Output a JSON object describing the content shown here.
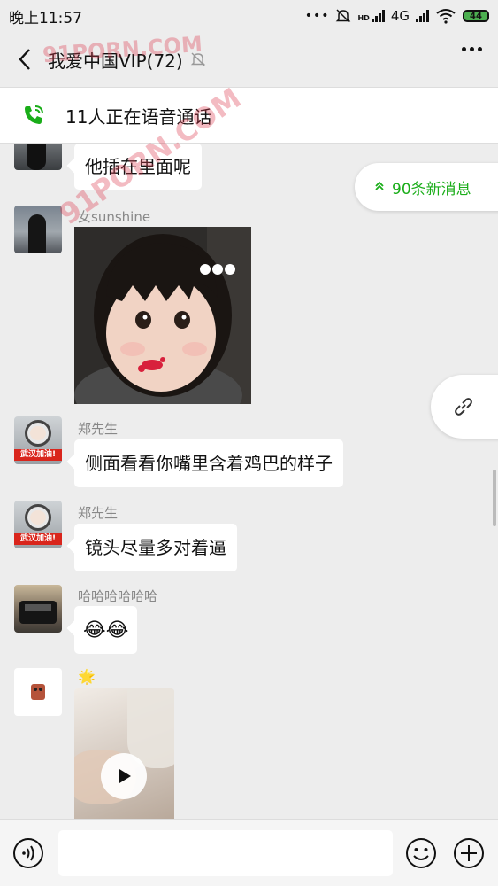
{
  "status_bar": {
    "time": "晚上11:57",
    "dots": "•••",
    "hd": "HD",
    "network": "4G",
    "battery": "44"
  },
  "nav": {
    "title": "我爱中国VIP(72)"
  },
  "voice_banner": {
    "text": "11人正在语音通话"
  },
  "new_messages": {
    "label": "90条新消息"
  },
  "messages": [
    {
      "text": "他插在里面呢"
    },
    {
      "sender": "女sunshine",
      "type": "image"
    },
    {
      "sender": "郑先生",
      "avatar_label": "武汉加油!",
      "text": "侧面看看你嘴里含着鸡巴的样子"
    },
    {
      "sender": "郑先生",
      "avatar_label": "武汉加油!",
      "text": "镜头尽量多对着逼"
    },
    {
      "sender": "哈哈哈哈哈哈",
      "text": "😂😂"
    },
    {
      "sender": "🌟",
      "type": "video"
    }
  ],
  "input": {
    "placeholder": ""
  },
  "colors": {
    "accent_green": "#1aad19",
    "background": "#ededed"
  },
  "watermark": {
    "text": "91PORN.COM"
  }
}
